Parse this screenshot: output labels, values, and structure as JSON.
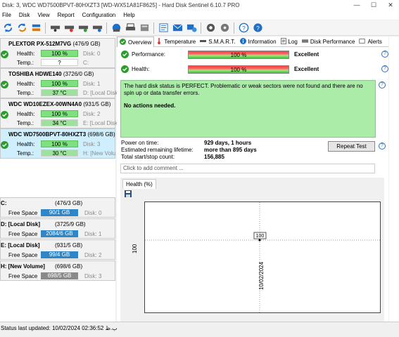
{
  "window": {
    "title": "Disk: 3, WDC WD7500BPVT-80HXZT3 [WD-WX51A81F8625]  -  Hard Disk Sentinel 6.10.7 PRO",
    "minimize": "—",
    "maximize": "☐",
    "close": "✕"
  },
  "menu": [
    "File",
    "Disk",
    "View",
    "Report",
    "Configuration",
    "Help"
  ],
  "toolbar_icons": [
    "refresh-icon",
    "refresh-all-icon",
    "sync-icon",
    "disk-test-icon",
    "disk-surface-icon",
    "disk-check-icon",
    "disk-info-icon",
    "save-report-icon",
    "print-icon",
    "hdd-report-icon",
    "send-report-icon",
    "email-icon",
    "web-status-icon",
    "settings-icon",
    "tools-icon",
    "help-icon",
    "about-icon"
  ],
  "disks": [
    {
      "name": "PLEXTOR PX-512M7VG",
      "size": "(476/9 GB)",
      "health_label": "Health:",
      "health": "100 %",
      "disk_id": "Disk: 0",
      "temp_label": "Temp.:",
      "temp": "?",
      "vol": "C:",
      "selected": false
    },
    {
      "name": "TOSHIBA HDWE140",
      "size": "(3726/0 GB)",
      "health_label": "Health:",
      "health": "100 %",
      "disk_id": "Disk: 1",
      "temp_label": "Temp.:",
      "temp": "37 °C",
      "vol": "D: [Local Disk]",
      "selected": false
    },
    {
      "name": "WDC WD10EZEX-00WN4A0",
      "size": "(931/5 GB)",
      "health_label": "Health:",
      "health": "100 %",
      "disk_id": "Disk: 2",
      "temp_label": "Temp.:",
      "temp": "34 °C",
      "vol": "E: [Local Disk]",
      "selected": false
    },
    {
      "name": "WDC WD7500BPVT-80HXZT3",
      "size": "(698/6 GB)",
      "health_label": "Health:",
      "health": "100 %",
      "disk_id": "Disk: 3",
      "temp_label": "Temp.:",
      "temp": "30 °C",
      "vol": "H: [New Volu",
      "selected": true
    }
  ],
  "volumes": [
    {
      "name": "C:",
      "size": "(476/3 GB)",
      "fs_label": "Free Space",
      "free": "90/1 GB",
      "disk": "Disk: 0",
      "color": "#2e86c8"
    },
    {
      "name": "D: [Local Disk]",
      "size": "(3725/9 GB)",
      "fs_label": "Free Space",
      "free": "2084/6 GB",
      "disk": "Disk: 1",
      "color": "#2e86c8"
    },
    {
      "name": "E: [Local Disk]",
      "size": "(931/5 GB)",
      "fs_label": "Free Space",
      "free": "99/4 GB",
      "disk": "Disk: 2",
      "color": "#2e86c8"
    },
    {
      "name": "H: [New Volume]",
      "size": "(698/6 GB)",
      "fs_label": "Free Space",
      "free": "698/5 GB",
      "disk": "Disk: 3",
      "color": "#8a8a8a"
    }
  ],
  "tabs": [
    "Overview",
    "Temperature",
    "S.M.A.R.T.",
    "Information",
    "Log",
    "Disk Performance",
    "Alerts"
  ],
  "overview": {
    "performance_label": "Performance:",
    "performance_value": "100 %",
    "performance_rating": "Excellent",
    "health_label": "Health:",
    "health_value": "100 %",
    "health_rating": "Excellent",
    "status_text": "The hard disk status is PERFECT. Problematic or weak sectors were not found and there are no spin up or data transfer errors.",
    "actions_text": "No actions needed.",
    "power_on_label": "Power on time:",
    "power_on_value": "929 days, 1 hours",
    "lifetime_label": "Estimated remaining lifetime:",
    "lifetime_value": "more than 895 days",
    "startstop_label": "Total start/stop count:",
    "startstop_value": "156,885",
    "repeat_button": "Repeat Test",
    "comment_placeholder": "Click to add comment ..."
  },
  "health_tab": "Health (%)",
  "chart_data": {
    "type": "scatter",
    "x": [
      "10/02/2024"
    ],
    "y": [
      100
    ],
    "point_label": "100",
    "ylabel": "",
    "ytick": "100",
    "xtick": "10/02/2024"
  },
  "statusbar": {
    "text": "Status last updated: 10/02/2024 02:36:52 ب.ظ"
  }
}
